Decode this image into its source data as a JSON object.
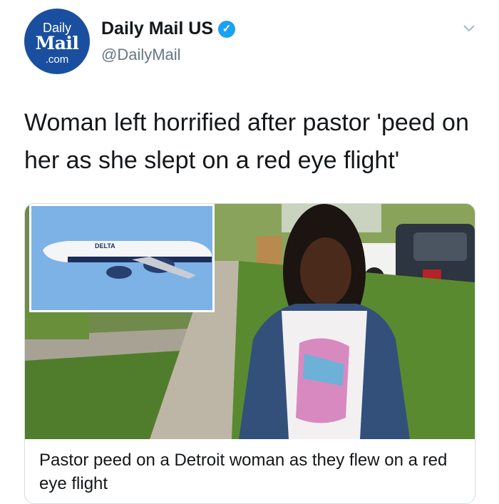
{
  "profile": {
    "avatar_line1": "Daily",
    "avatar_line2": "Mail",
    "avatar_line3": ".com",
    "display_name": "Daily Mail US",
    "handle": "@DailyMail",
    "verified": true
  },
  "tweet": {
    "text": "Woman left horrified after pastor 'peed on her as she slept on a red eye flight'"
  },
  "card": {
    "inset_airline": "DELTA",
    "caption": "Pastor peed on a Detroit woman as they flew on a red eye flight"
  },
  "icons": {
    "verified": "verified-badge-icon",
    "menu": "chevron-down-icon"
  },
  "colors": {
    "avatar_bg": "#1a4fa0",
    "verified": "#1da1f2",
    "handle": "#657786"
  }
}
